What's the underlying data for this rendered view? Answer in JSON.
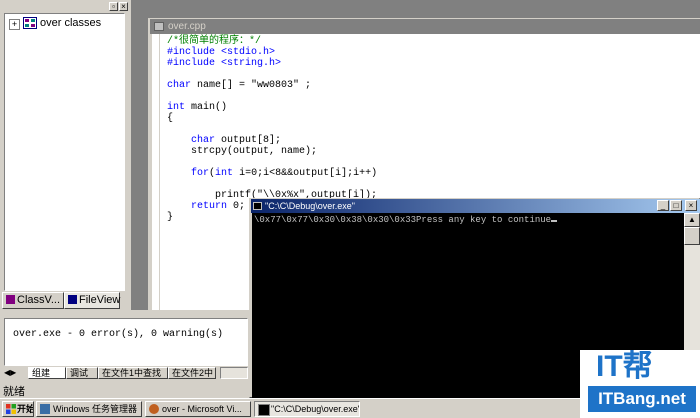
{
  "workspace": {
    "tree_root_label": "over classes",
    "tabs": [
      {
        "label": "ClassV..."
      },
      {
        "label": "FileView"
      }
    ]
  },
  "editor": {
    "tab_title": "over.cpp",
    "code_lines": [
      {
        "text": "/*很简单的程序：*/",
        "kind": "comment"
      },
      {
        "text": "#include <stdio.h>",
        "kind": "include"
      },
      {
        "text": "#include <string.h>",
        "kind": "include"
      },
      {
        "text": "",
        "kind": "plain"
      },
      {
        "text": "char name[] = \"ww0803\" ;",
        "kind": "decl"
      },
      {
        "text": "",
        "kind": "plain"
      },
      {
        "text": "int main()",
        "kind": "decl"
      },
      {
        "text": "{",
        "kind": "plain"
      },
      {
        "text": "",
        "kind": "plain"
      },
      {
        "text": "    char output[8];",
        "kind": "decl"
      },
      {
        "text": "    strcpy(output, name);",
        "kind": "plain"
      },
      {
        "text": "",
        "kind": "plain"
      },
      {
        "text": "    for(int i=0;i<8&&output[i];i++)",
        "kind": "for"
      },
      {
        "text": "",
        "kind": "plain"
      },
      {
        "text": "        printf(\"\\\\0x%x\",output[i]);",
        "kind": "plain"
      },
      {
        "text": "    return 0;",
        "kind": "return"
      },
      {
        "text": "}",
        "kind": "plain"
      }
    ]
  },
  "output": {
    "message": "over.exe - 0 error(s), 0 warning(s)",
    "tabs": [
      {
        "label": "组建"
      },
      {
        "label": "调试"
      },
      {
        "label": "在文件1中查找"
      },
      {
        "label": "在文件2中"
      }
    ]
  },
  "status_bar": {
    "text": "就绪"
  },
  "console": {
    "title": "\"C:\\C\\Debug\\over.exe\"",
    "output": "\\0x77\\0x77\\0x30\\0x38\\0x30\\0x33Press any key to continue"
  },
  "taskbar": {
    "start_label": "开始",
    "tasks": [
      {
        "label": "Windows 任务管理器"
      },
      {
        "label": "over - Microsoft Vi..."
      },
      {
        "label": "\"C:\\C\\Debug\\over.exe\""
      }
    ]
  },
  "watermark": {
    "brand_top": "IT帮",
    "brand_bottom": "ITBang.net"
  },
  "colors": {
    "keyword": "#0000ff",
    "comment": "#008000",
    "face": "#d4d0c8",
    "title_active_start": "#0a246a",
    "title_active_end": "#a6caf0",
    "watermark_blue": "#1e73c8"
  }
}
